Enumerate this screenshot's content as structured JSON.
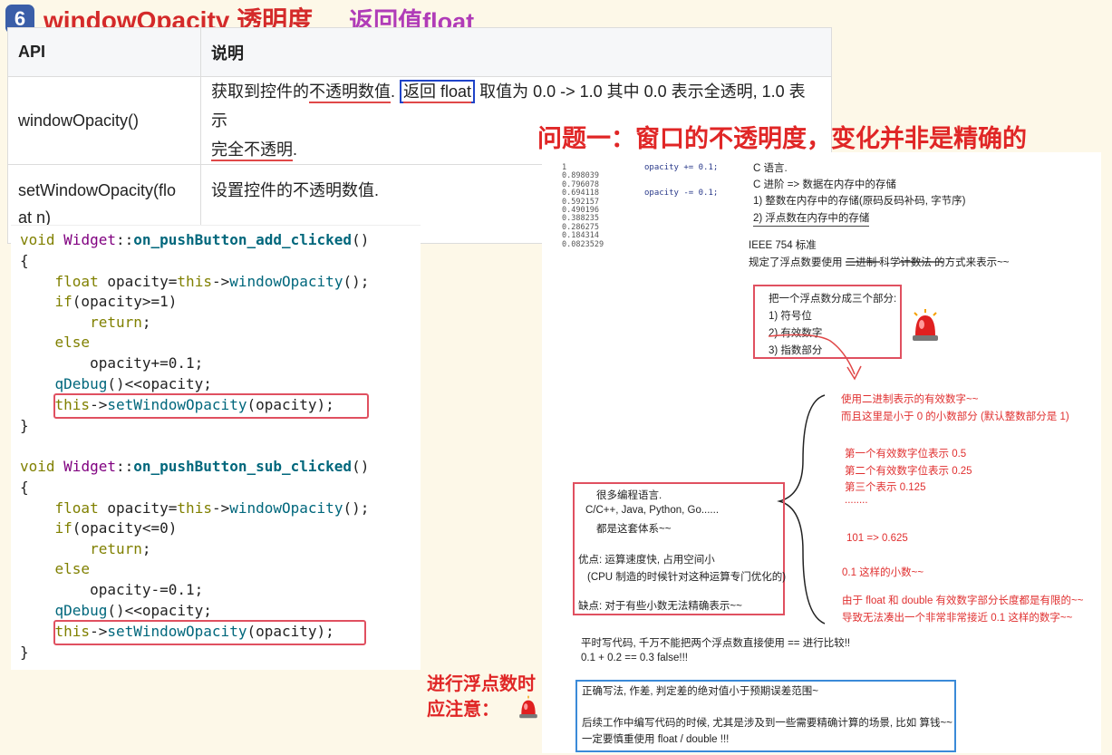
{
  "heading": {
    "badge": "6",
    "title": "windowOpacity 透明度",
    "return_note": "返回值float"
  },
  "table": {
    "headers": [
      "API",
      "说明"
    ],
    "rows": [
      {
        "api": "windowOpacity()",
        "desc_a": "获取到控件的",
        "desc_b": "不透明数值",
        "desc_c": ".",
        "desc_box": "返回 float",
        "desc_d": " 取值为 0.0 -> 1.0 其中 0.0 表示全透明, 1.0 表示",
        "desc_e": "完全不透明",
        "desc_f": "."
      },
      {
        "api_a": "setWindowOpacity(flo",
        "api_b": "at n)",
        "desc": "设置控件的不透明数值."
      }
    ]
  },
  "problem": "问题一：窗口的不透明度，变化并非是精确的",
  "code": {
    "add_func": "on_pushButton_add_clicked",
    "sub_func": "on_pushButton_sub_clicked",
    "class_name": "Widget",
    "ret_type": "void",
    "window_opacity": "windowOpacity",
    "set_window_opacity": "setWindowOpacity",
    "qdebug": "qDebug",
    "var": "opacity",
    "this": "this",
    "float": "float",
    "if": "if",
    "else": "else",
    "return": "return",
    "cond_add": "(opacity>=1)",
    "cond_sub": "(opacity<=0)",
    "inc": "opacity+=0.1;",
    "dec": "opacity-=0.1;"
  },
  "notes": {
    "values": "1\n0.898039\n0.796078\n0.694118\n0.592157\n0.490196\n0.388235\n0.286275\n0.184314\n0.0823529",
    "inc": "opacity += 0.1;",
    "dec": "opacity -= 0.1;",
    "c_lang": "C 语言.",
    "c_adv": "C 进阶 => 数据在内存中的存储",
    "int_store": "1) 整数在内存中的存储(原码反码补码, 字节序)",
    "float_store": "2) 浮点数在内存中的存储",
    "ieee": "IEEE 754 标准",
    "rule": "规定了浮点数要使用 二进制 科学计数法 的方式来表示~~",
    "split": "把一个浮点数分成三个部分:",
    "p1": "1) 符号位",
    "p2": "2) 有效数字",
    "p3": "3) 指数部分",
    "r1": "使用二进制表示的有效数字~~",
    "r2": "而且这里是小于 0 的小数部分 (默认整数部分是 1)",
    "r3": "第一个有效数字位表示 0.5",
    "r4": "第二个有效数字位表示 0.25",
    "r5": "第三个表示 0.125",
    "r6": "........",
    "r7": "101  => 0.625",
    "r8": "0.1 这样的小数~~",
    "r9": "由于 float 和 double 有效数字部分长度都是有限的~~",
    "r10": "导致无法凑出一个非常非常接近 0.1 这样的数字~~",
    "lang1": "很多编程语言.",
    "lang2": "C/C++, Java, Python, Go......",
    "lang3": "都是这套体系~~",
    "pro": "优点: 运算速度快, 占用空间小",
    "pro2": "(CPU 制造的时候针对这种运算专门优化的)",
    "con": "缺点: 对于有些小数无法精确表示~~",
    "w1": "平时写代码, 千万不能把两个浮点数直接使用 == 进行比较!!",
    "w2": "0.1 + 0.2 == 0.3    false!!!",
    "b1": "正确写法, 作差, 判定差的绝对值小于预期误差范围~",
    "b2": "后续工作中编写代码的时候, 尤其是涉及到一些需要精确计算的场景, 比如 算钱~~",
    "b3": "一定要慎重使用 float / double !!!"
  },
  "warning": {
    "line1": "进行浮点数时",
    "line2": "应注意："
  },
  "colors": {
    "red": "#e02626",
    "purple": "#b03cb8",
    "badge": "#3a5ea8",
    "blue_box": "#1f43c8"
  }
}
